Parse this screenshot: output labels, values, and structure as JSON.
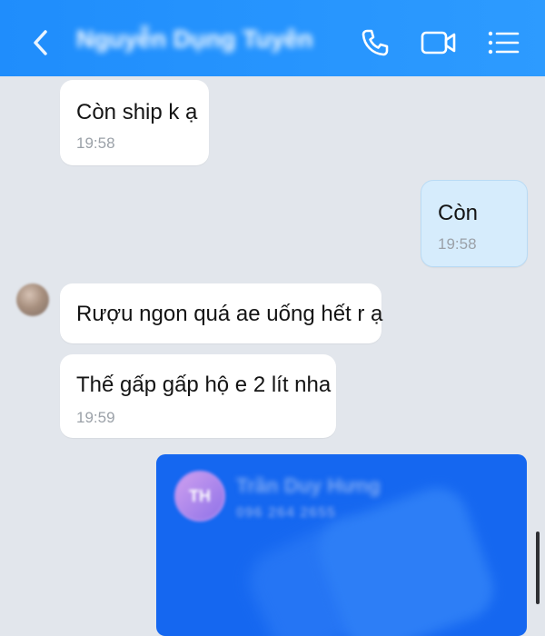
{
  "header": {
    "contact_name": "Nguyễn Dụng Tuyên",
    "back_icon": "chevron-left-icon",
    "call_icon": "phone-icon",
    "video_icon": "video-camera-icon",
    "menu_icon": "list-menu-icon"
  },
  "messages": [
    {
      "sender": "other",
      "text": "Còn ship k ạ",
      "time": "19:58"
    },
    {
      "sender": "me",
      "text": "Còn",
      "time": "19:58"
    },
    {
      "sender": "other",
      "text": "Rượu ngon quá ae uống hết r ạ",
      "time": ""
    },
    {
      "sender": "other",
      "text": "Thế gấp gấp hộ e 2 lít nha",
      "time": "19:59"
    }
  ],
  "contact_card": {
    "initials": "TH",
    "name": "Trần Duy Hưng",
    "phone": "096 264 2655"
  },
  "colors": {
    "header": "#1f8dfc",
    "background": "#e2e6ec",
    "my_bubble": "#d6ecfc",
    "card": "#1567f0"
  }
}
